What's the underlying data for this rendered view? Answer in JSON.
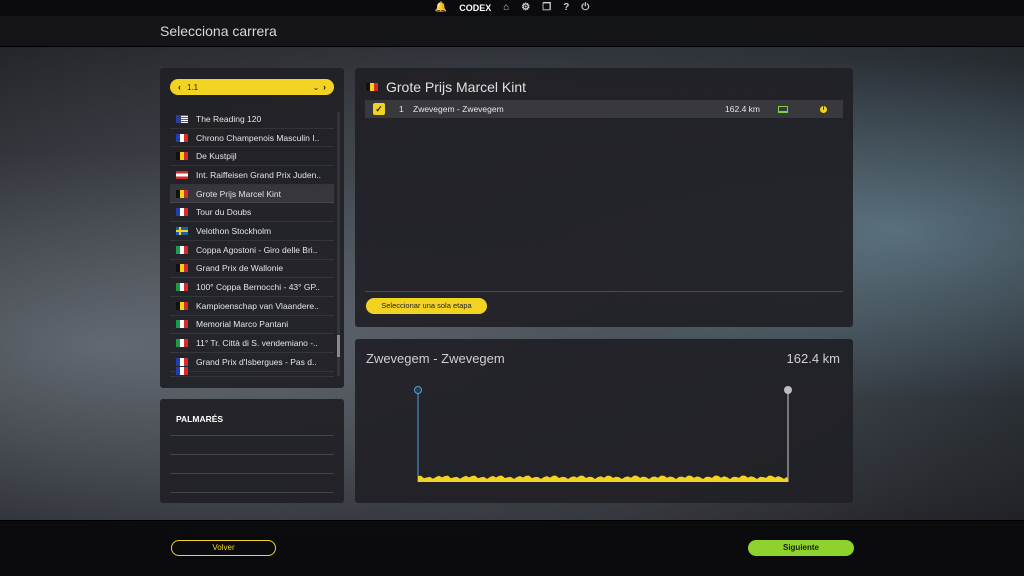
{
  "topbar": {
    "brand": "CODEX",
    "icons": [
      "bell-icon",
      "home-icon",
      "gear-icon",
      "copy-icon",
      "help-icon",
      "power-icon"
    ]
  },
  "header": {
    "title": "Selecciona carrera"
  },
  "race_list": {
    "category": "1.1",
    "races": [
      {
        "name": "The Reading 120",
        "flag": "us",
        "cut": false
      },
      {
        "name": "Chrono Champenois Masculin I..",
        "flag": "fr",
        "cut": false
      },
      {
        "name": "De Kustpijl",
        "flag": "be",
        "cut": false
      },
      {
        "name": "Int. Raiffeisen Grand Prix Juden..",
        "flag": "at",
        "cut": false
      },
      {
        "name": "Grote Prijs Marcel Kint",
        "flag": "be",
        "cut": false,
        "selected": true
      },
      {
        "name": "Tour du Doubs",
        "flag": "fr",
        "cut": false
      },
      {
        "name": "Velothon Stockholm",
        "flag": "se",
        "cut": false
      },
      {
        "name": "Coppa Agostoni - Giro delle Bri..",
        "flag": "it",
        "cut": false
      },
      {
        "name": "Grand Prix de Wallonie",
        "flag": "be",
        "cut": false
      },
      {
        "name": "100° Coppa Bernocchi - 43° GP..",
        "flag": "it",
        "cut": false
      },
      {
        "name": "Kampioenschap van Vlaandere..",
        "flag": "be",
        "cut": false
      },
      {
        "name": "Memorial Marco Pantani",
        "flag": "it",
        "cut": false
      },
      {
        "name": "11° Tr. Città di S. vendemiano -..",
        "flag": "it",
        "cut": false
      },
      {
        "name": "Grand Prix d'Isbergues - Pas d..",
        "flag": "fr",
        "cut": false
      },
      {
        "name": "",
        "flag": "fr",
        "cut": true
      }
    ]
  },
  "palmares": {
    "heading": "PALMARÉS"
  },
  "race_detail": {
    "title": "Grote Prijs Marcel Kint",
    "flag": "be",
    "stages": [
      {
        "number": "1",
        "name": "Zwevegem - Zwevegem",
        "distance": "162.4 km",
        "checked": true
      }
    ],
    "single_stage_button": "Seleccionar una sola etapa"
  },
  "stage_profile": {
    "name": "Zwevegem - Zwevegem",
    "distance": "162.4 km"
  },
  "footer": {
    "back_label": "Volver",
    "next_label": "Siguiente"
  },
  "colors": {
    "accent": "#f3d321",
    "next": "#8ed22e",
    "panel": "#202026"
  }
}
